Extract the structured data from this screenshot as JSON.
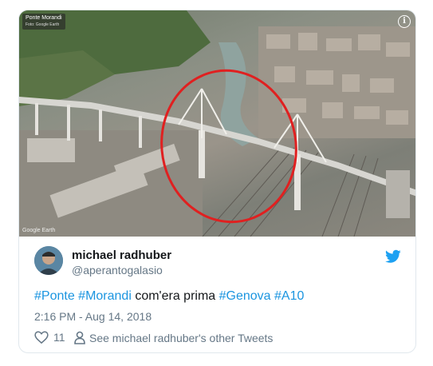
{
  "media": {
    "map_title": "Ponte Morandi",
    "map_subtitle": "Foto: Google Earth",
    "watermark": "Google Earth",
    "info_icon": "info-icon"
  },
  "author": {
    "display_name": "michael radhuber",
    "handle": "@aperantogalasio",
    "avatar_icon": "avatar"
  },
  "tweet": {
    "parts": [
      {
        "text": "#Ponte",
        "hashtag": true
      },
      {
        "text": " ",
        "hashtag": false
      },
      {
        "text": "#Morandi",
        "hashtag": true
      },
      {
        "text": " com'era prima ",
        "hashtag": false
      },
      {
        "text": "#Genova",
        "hashtag": true
      },
      {
        "text": " ",
        "hashtag": false
      },
      {
        "text": "#A10",
        "hashtag": true
      }
    ],
    "timestamp": "2:16 PM - Aug 14, 2018"
  },
  "actions": {
    "like_count": "11",
    "other_tweets_label": "See michael radhuber's other Tweets"
  },
  "colors": {
    "hashtag": "#1b95e0",
    "twitter_blue": "#1da1f2",
    "muted": "#657786",
    "circle": "#e02020"
  }
}
